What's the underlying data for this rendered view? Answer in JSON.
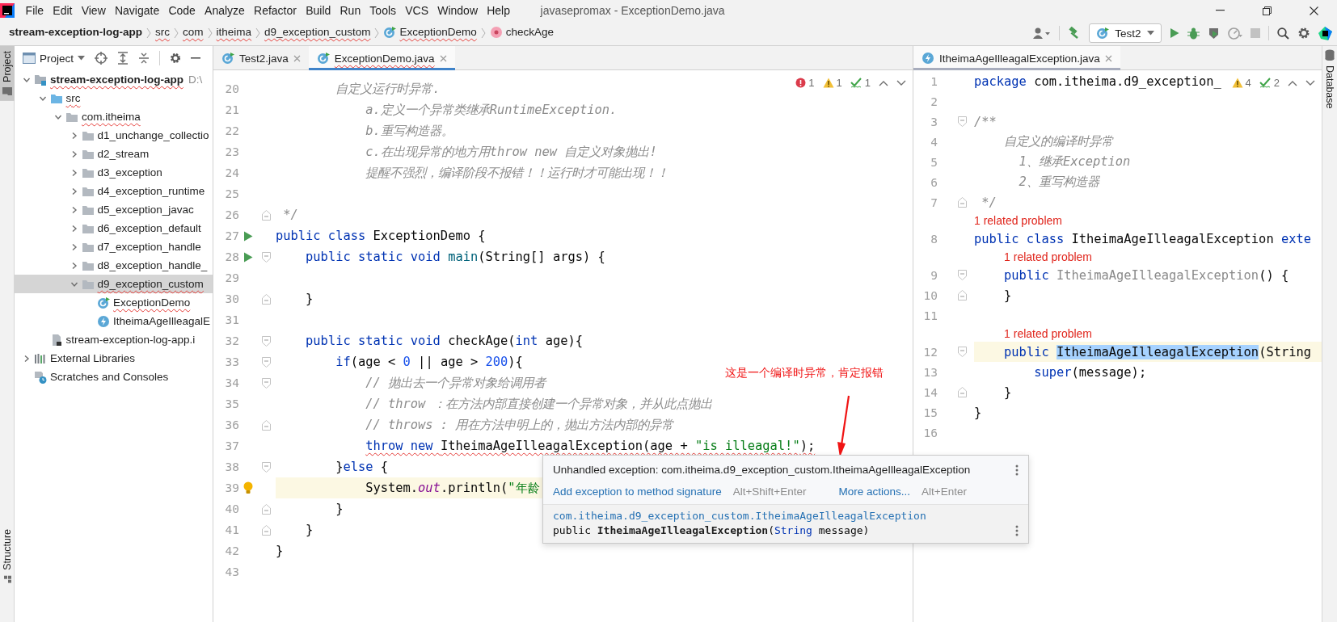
{
  "menu_bar": {
    "items": [
      "File",
      "Edit",
      "View",
      "Navigate",
      "Code",
      "Analyze",
      "Refactor",
      "Build",
      "Run",
      "Tools",
      "VCS",
      "Window",
      "Help"
    ],
    "title": "javasepromax - ExceptionDemo.java"
  },
  "navigation_bar": {
    "breadcrumbs": [
      {
        "label": "stream-exception-log-app",
        "kind": "project",
        "error": false
      },
      {
        "label": "src",
        "kind": "folder",
        "error": true
      },
      {
        "label": "com",
        "kind": "folder",
        "error": true
      },
      {
        "label": "itheima",
        "kind": "folder",
        "error": true
      },
      {
        "label": "d9_exception_custom",
        "kind": "folder",
        "error": true
      },
      {
        "label": "ExceptionDemo",
        "kind": "class",
        "error": true
      },
      {
        "label": "checkAge",
        "kind": "method",
        "error": false
      }
    ],
    "run_config": "Test2"
  },
  "left_strip": {
    "tabs": [
      {
        "label": "Project",
        "selected": true
      },
      {
        "label": "Structure",
        "selected": false
      }
    ]
  },
  "project_panel": {
    "title": "Project",
    "tree": [
      {
        "label": "stream-exception-log-app",
        "path": "D:\\",
        "kind": "module",
        "expanded": true,
        "selected": false,
        "error": true,
        "children": [
          {
            "label": "src",
            "kind": "src",
            "expanded": true,
            "selected": false,
            "error": true,
            "children": [
              {
                "label": "com.itheima",
                "kind": "package",
                "expanded": true,
                "selected": false,
                "error": true,
                "children": [
                  {
                    "label": "d1_unchange_collectio",
                    "kind": "package",
                    "expanded": false,
                    "selected": false,
                    "error": false
                  },
                  {
                    "label": "d2_stream",
                    "kind": "package",
                    "expanded": false,
                    "selected": false,
                    "error": false
                  },
                  {
                    "label": "d3_exception",
                    "kind": "package",
                    "expanded": false,
                    "selected": false,
                    "error": false
                  },
                  {
                    "label": "d4_exception_runtime",
                    "kind": "package",
                    "expanded": false,
                    "selected": false,
                    "error": false
                  },
                  {
                    "label": "d5_exception_javac",
                    "kind": "package",
                    "expanded": false,
                    "selected": false,
                    "error": false
                  },
                  {
                    "label": "d6_exception_default",
                    "kind": "package",
                    "expanded": false,
                    "selected": false,
                    "error": false
                  },
                  {
                    "label": "d7_exception_handle",
                    "kind": "package",
                    "expanded": false,
                    "selected": false,
                    "error": false
                  },
                  {
                    "label": "d8_exception_handle_",
                    "kind": "package",
                    "expanded": false,
                    "selected": false,
                    "error": false
                  },
                  {
                    "label": "d9_exception_custom",
                    "kind": "package",
                    "expanded": true,
                    "selected": true,
                    "error": true,
                    "children": [
                      {
                        "label": "ExceptionDemo",
                        "kind": "class",
                        "selected": false,
                        "error": true
                      },
                      {
                        "label": "ItheimaAgeIlleagalE",
                        "kind": "exception",
                        "selected": false,
                        "error": false
                      }
                    ]
                  }
                ]
              }
            ]
          },
          {
            "label": "stream-exception-log-app.i",
            "kind": "file",
            "selected": false,
            "error": false
          }
        ]
      },
      {
        "label": "External Libraries",
        "kind": "library",
        "expanded": false,
        "selected": false,
        "error": false
      },
      {
        "label": "Scratches and Consoles",
        "kind": "scratches",
        "selected": false,
        "error": false
      }
    ]
  },
  "left_editor": {
    "focused": true,
    "tabs": [
      {
        "label": "Test2.java",
        "kind": "class",
        "selected": false,
        "error": false
      },
      {
        "label": "ExceptionDemo.java",
        "kind": "class",
        "selected": true,
        "error": true
      }
    ],
    "inspections": [
      {
        "kind": "error",
        "count": "1"
      },
      {
        "kind": "warning",
        "count": "1"
      },
      {
        "kind": "typo",
        "count": "1"
      }
    ],
    "lines": [
      {
        "kind": "code",
        "number": "20",
        "tokens": [
          {
            "text": "        自定义运行时异常.",
            "kind": "comment"
          }
        ]
      },
      {
        "kind": "code",
        "number": "21",
        "tokens": [
          {
            "text": "            a.定义一个异常类继承RuntimeException.",
            "kind": "comment"
          }
        ]
      },
      {
        "kind": "code",
        "number": "22",
        "tokens": [
          {
            "text": "            b.重写构造器。",
            "kind": "comment"
          }
        ]
      },
      {
        "kind": "code",
        "number": "23",
        "tokens": [
          {
            "text": "            c.在出现异常的地方用throw new 自定义对象抛出!",
            "kind": "comment"
          }
        ]
      },
      {
        "kind": "code",
        "number": "24",
        "tokens": [
          {
            "text": "            提醒不强烈，编译阶段不报错！！运行时才可能出现！！",
            "kind": "comment"
          }
        ]
      },
      {
        "kind": "code",
        "number": "25"
      },
      {
        "kind": "code",
        "number": "26",
        "gutter": [
          {
            "kind": "fold-close"
          }
        ],
        "tokens": [
          {
            "text": " */",
            "kind": "comment"
          }
        ]
      },
      {
        "kind": "code",
        "number": "27",
        "gutter": [
          {
            "kind": "run"
          }
        ],
        "tokens": [
          {
            "text": "public class ",
            "kind": "kw"
          },
          {
            "text": "ExceptionDemo {",
            "kind": "plain"
          }
        ]
      },
      {
        "kind": "code",
        "number": "28",
        "gutter": [
          {
            "kind": "run"
          },
          {
            "kind": "fold-open"
          }
        ],
        "tokens": [
          {
            "text": "    public static void ",
            "kind": "kw"
          },
          {
            "text": "main",
            "kind": "method"
          },
          {
            "text": "(String[] args) {",
            "kind": "plain"
          }
        ]
      },
      {
        "kind": "code",
        "number": "29"
      },
      {
        "kind": "code",
        "number": "30",
        "gutter": [
          {
            "kind": "fold-close"
          }
        ],
        "tokens": [
          {
            "text": "    }",
            "kind": "plain"
          }
        ]
      },
      {
        "kind": "code",
        "number": "31"
      },
      {
        "kind": "code",
        "number": "32",
        "gutter": [
          {
            "kind": "fold-open"
          }
        ],
        "tokens": [
          {
            "text": "    public static void ",
            "kind": "kw"
          },
          {
            "text": "checkAge(",
            "kind": "plain"
          },
          {
            "text": "int",
            "kind": "kw"
          },
          {
            "text": " age){",
            "kind": "plain"
          }
        ]
      },
      {
        "kind": "code",
        "number": "33",
        "gutter": [
          {
            "kind": "fold-open"
          }
        ],
        "tokens": [
          {
            "text": "        if",
            "kind": "kw"
          },
          {
            "text": "(age < ",
            "kind": "plain"
          },
          {
            "text": "0",
            "kind": "num"
          },
          {
            "text": " || age > ",
            "kind": "plain"
          },
          {
            "text": "200",
            "kind": "num"
          },
          {
            "text": "){",
            "kind": "plain"
          }
        ]
      },
      {
        "kind": "code",
        "number": "34",
        "gutter": [
          {
            "kind": "fold-open"
          }
        ],
        "tokens": [
          {
            "text": "            // 抛出去一个异常对象给调用者",
            "kind": "comment"
          }
        ]
      },
      {
        "kind": "code",
        "number": "35",
        "tokens": [
          {
            "text": "            // throw ：在方法内部直接创建一个异常对象，并从此点抛出",
            "kind": "comment"
          }
        ]
      },
      {
        "kind": "code",
        "number": "36",
        "gutter": [
          {
            "kind": "fold-close"
          }
        ],
        "tokens": [
          {
            "text": "            // throws : 用在方法申明上的，抛出方法内部的异常",
            "kind": "comment"
          }
        ]
      },
      {
        "kind": "code",
        "number": "37",
        "error": true,
        "tokens": [
          {
            "text": "            throw new ",
            "kind": "kw"
          },
          {
            "text": "ItheimaAgeIlleagalException(age + ",
            "kind": "plain"
          },
          {
            "text": "\"is illeagal!\"",
            "kind": "str"
          },
          {
            "text": ");",
            "kind": "plain"
          }
        ]
      },
      {
        "kind": "code",
        "number": "38",
        "gutter": [
          {
            "kind": "fold-open"
          }
        ],
        "tokens": [
          {
            "text": "        }",
            "kind": "plain"
          },
          {
            "text": "else",
            "kind": "kw"
          },
          {
            "text": " {",
            "kind": "plain"
          }
        ]
      },
      {
        "kind": "code",
        "number": "39",
        "gutter": [
          {
            "kind": "bulb"
          }
        ],
        "current": true,
        "tokens": [
          {
            "text": "            System.",
            "kind": "plain"
          },
          {
            "text": "out",
            "kind": "field"
          },
          {
            "text": ".println(",
            "kind": "plain"
          },
          {
            "text": "\"年龄",
            "kind": "str"
          }
        ]
      },
      {
        "kind": "code",
        "number": "40",
        "gutter": [
          {
            "kind": "fold-close"
          }
        ],
        "tokens": [
          {
            "text": "        }",
            "kind": "plain"
          }
        ]
      },
      {
        "kind": "code",
        "number": "41",
        "gutter": [
          {
            "kind": "fold-close"
          }
        ],
        "tokens": [
          {
            "text": "    }",
            "kind": "plain"
          }
        ]
      },
      {
        "kind": "code",
        "number": "42",
        "tokens": [
          {
            "text": "}",
            "kind": "plain"
          }
        ]
      },
      {
        "kind": "code",
        "number": "43"
      }
    ]
  },
  "right_editor": {
    "focused": false,
    "tabs": [
      {
        "label": "ItheimaAgeIlleagalException.java",
        "kind": "exception",
        "selected": true,
        "error": false
      }
    ],
    "inspections": [
      {
        "kind": "warning",
        "count": "4"
      },
      {
        "kind": "typo",
        "count": "2"
      }
    ],
    "lines": [
      {
        "kind": "code",
        "number": "1",
        "tokens": [
          {
            "text": "package",
            "kind": "kw"
          },
          {
            "text": " com.itheima.d9_exception_",
            "kind": "plain"
          }
        ]
      },
      {
        "kind": "code",
        "number": "2"
      },
      {
        "kind": "code",
        "number": "3",
        "gutter": [
          {
            "kind": "fold-open"
          }
        ],
        "tokens": [
          {
            "text": "/**",
            "kind": "comment"
          }
        ]
      },
      {
        "kind": "code",
        "number": "4",
        "tokens": [
          {
            "text": "    自定义的编译时异常",
            "kind": "comment"
          }
        ]
      },
      {
        "kind": "code",
        "number": "5",
        "tokens": [
          {
            "text": "      1、继承Exception",
            "kind": "comment"
          }
        ]
      },
      {
        "kind": "code",
        "number": "6",
        "tokens": [
          {
            "text": "      2、重写构造器",
            "kind": "comment"
          }
        ]
      },
      {
        "kind": "code",
        "number": "7",
        "gutter": [
          {
            "kind": "fold-close"
          }
        ],
        "tokens": [
          {
            "text": " */",
            "kind": "comment"
          }
        ]
      },
      {
        "kind": "inlay",
        "text": "1 related problem"
      },
      {
        "kind": "code",
        "number": "8",
        "tokens": [
          {
            "text": "public class ",
            "kind": "kw"
          },
          {
            "text": "ItheimaAgeIlleagalException ",
            "kind": "plain"
          },
          {
            "text": "exte",
            "kind": "kw"
          }
        ]
      },
      {
        "kind": "inlay",
        "text": "    1 related problem"
      },
      {
        "kind": "code",
        "number": "9",
        "gutter": [
          {
            "kind": "fold-open"
          }
        ],
        "tokens": [
          {
            "text": "    public ",
            "kind": "kw"
          },
          {
            "text": "ItheimaAgeIlleagalException",
            "kind": "unused"
          },
          {
            "text": "() {",
            "kind": "plain"
          }
        ]
      },
      {
        "kind": "code",
        "number": "10",
        "gutter": [
          {
            "kind": "fold-close"
          }
        ],
        "tokens": [
          {
            "text": "    }",
            "kind": "plain"
          }
        ]
      },
      {
        "kind": "code",
        "number": "11"
      },
      {
        "kind": "inlay",
        "text": "    1 related problem"
      },
      {
        "kind": "code",
        "number": "12",
        "gutter": [
          {
            "kind": "fold-open"
          }
        ],
        "current": true,
        "tokens": [
          {
            "text": "    public ",
            "kind": "kw"
          },
          {
            "text": "ItheimaAgeIlleagalException",
            "kind": "hl"
          },
          {
            "text": "(String",
            "kind": "plain"
          }
        ]
      },
      {
        "kind": "code",
        "number": "13",
        "tokens": [
          {
            "text": "        super",
            "kind": "kw"
          },
          {
            "text": "(message);",
            "kind": "plain"
          }
        ]
      },
      {
        "kind": "code",
        "number": "14",
        "gutter": [
          {
            "kind": "fold-close"
          }
        ],
        "tokens": [
          {
            "text": "    }",
            "kind": "plain"
          }
        ]
      },
      {
        "kind": "code",
        "number": "15",
        "tokens": [
          {
            "text": "}",
            "kind": "plain"
          }
        ]
      },
      {
        "kind": "code",
        "number": "16"
      }
    ]
  },
  "right_strip": {
    "tabs": [
      {
        "label": "Database",
        "selected": false
      }
    ]
  },
  "popup": {
    "message": "Unhandled exception: com.itheima.d9_exception_custom.ItheimaAgeIlleagalException",
    "actions": [
      {
        "label": "Add exception to method signature",
        "shortcut": "Alt+Shift+Enter"
      },
      {
        "label": "More actions...",
        "shortcut": "Alt+Enter"
      }
    ],
    "doc": {
      "qualified_name": "com.itheima.d9_exception_custom.ItheimaAgeIlleagalException",
      "signature": [
        {
          "text": "public ",
          "kind": "plain"
        },
        {
          "text": "ItheimaAgeIlleagalException",
          "kind": "bold"
        },
        {
          "text": "(",
          "kind": "plain"
        },
        {
          "text": "String",
          "kind": "type"
        },
        {
          "text": " message)",
          "kind": "plain"
        }
      ]
    }
  },
  "annotation": {
    "text": "这是一个编译时异常，肯定报错"
  }
}
